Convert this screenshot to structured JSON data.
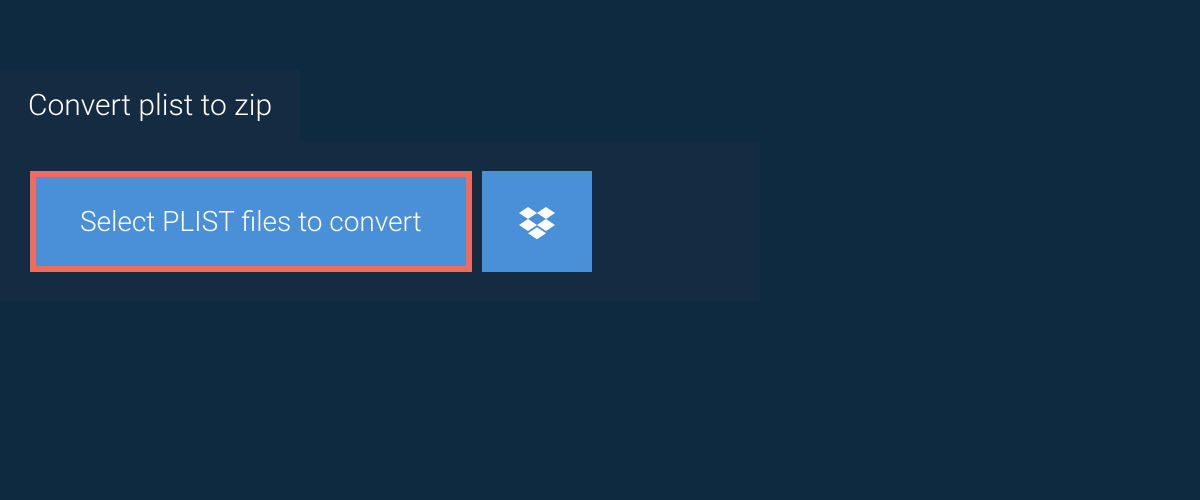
{
  "tab": {
    "label": "Convert plist to zip"
  },
  "panel": {
    "select_button_label": "Select PLIST files to convert"
  },
  "colors": {
    "background": "#0e2a40",
    "panel": "#152b42",
    "button": "#4a90d9",
    "highlight_border": "#ee6b5f",
    "text": "#ffffff"
  }
}
